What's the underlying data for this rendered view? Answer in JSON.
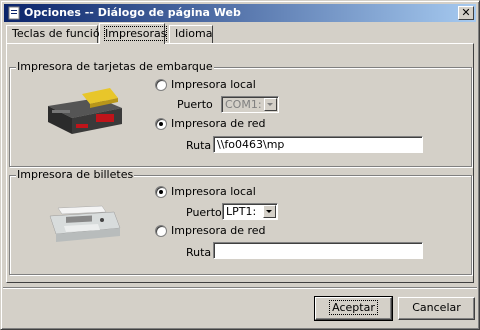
{
  "window": {
    "title": "Opciones -- Diálogo de página Web",
    "close_glyph": "✕"
  },
  "tabs": [
    {
      "label": "Teclas de función",
      "active": false
    },
    {
      "label": "Impresoras",
      "active": true
    },
    {
      "label": "Idioma",
      "active": false
    }
  ],
  "boarding_group": {
    "title": "Impresora de tarjetas de embarque",
    "local_label": "Impresora local",
    "local_checked": false,
    "port_label": "Puerto",
    "port_value": "COM1:",
    "port_disabled": true,
    "network_label": "Impresora de red",
    "network_checked": true,
    "path_label": "Ruta",
    "path_value": "\\\\fo0463\\mp"
  },
  "ticket_group": {
    "title": "Impresora de billetes",
    "local_label": "Impresora local",
    "local_checked": true,
    "port_label": "Puerto",
    "port_value": "LPT1:",
    "port_disabled": false,
    "network_label": "Impresora de red",
    "network_checked": false,
    "path_label": "Ruta",
    "path_value": ""
  },
  "buttons": {
    "accept_label": "Aceptar",
    "cancel_label": "Cancelar"
  },
  "icons": {
    "window_icon": "document-icon",
    "boarding_printer_icon": "boarding-pass-printer-icon",
    "ticket_printer_icon": "dot-matrix-printer-icon"
  }
}
